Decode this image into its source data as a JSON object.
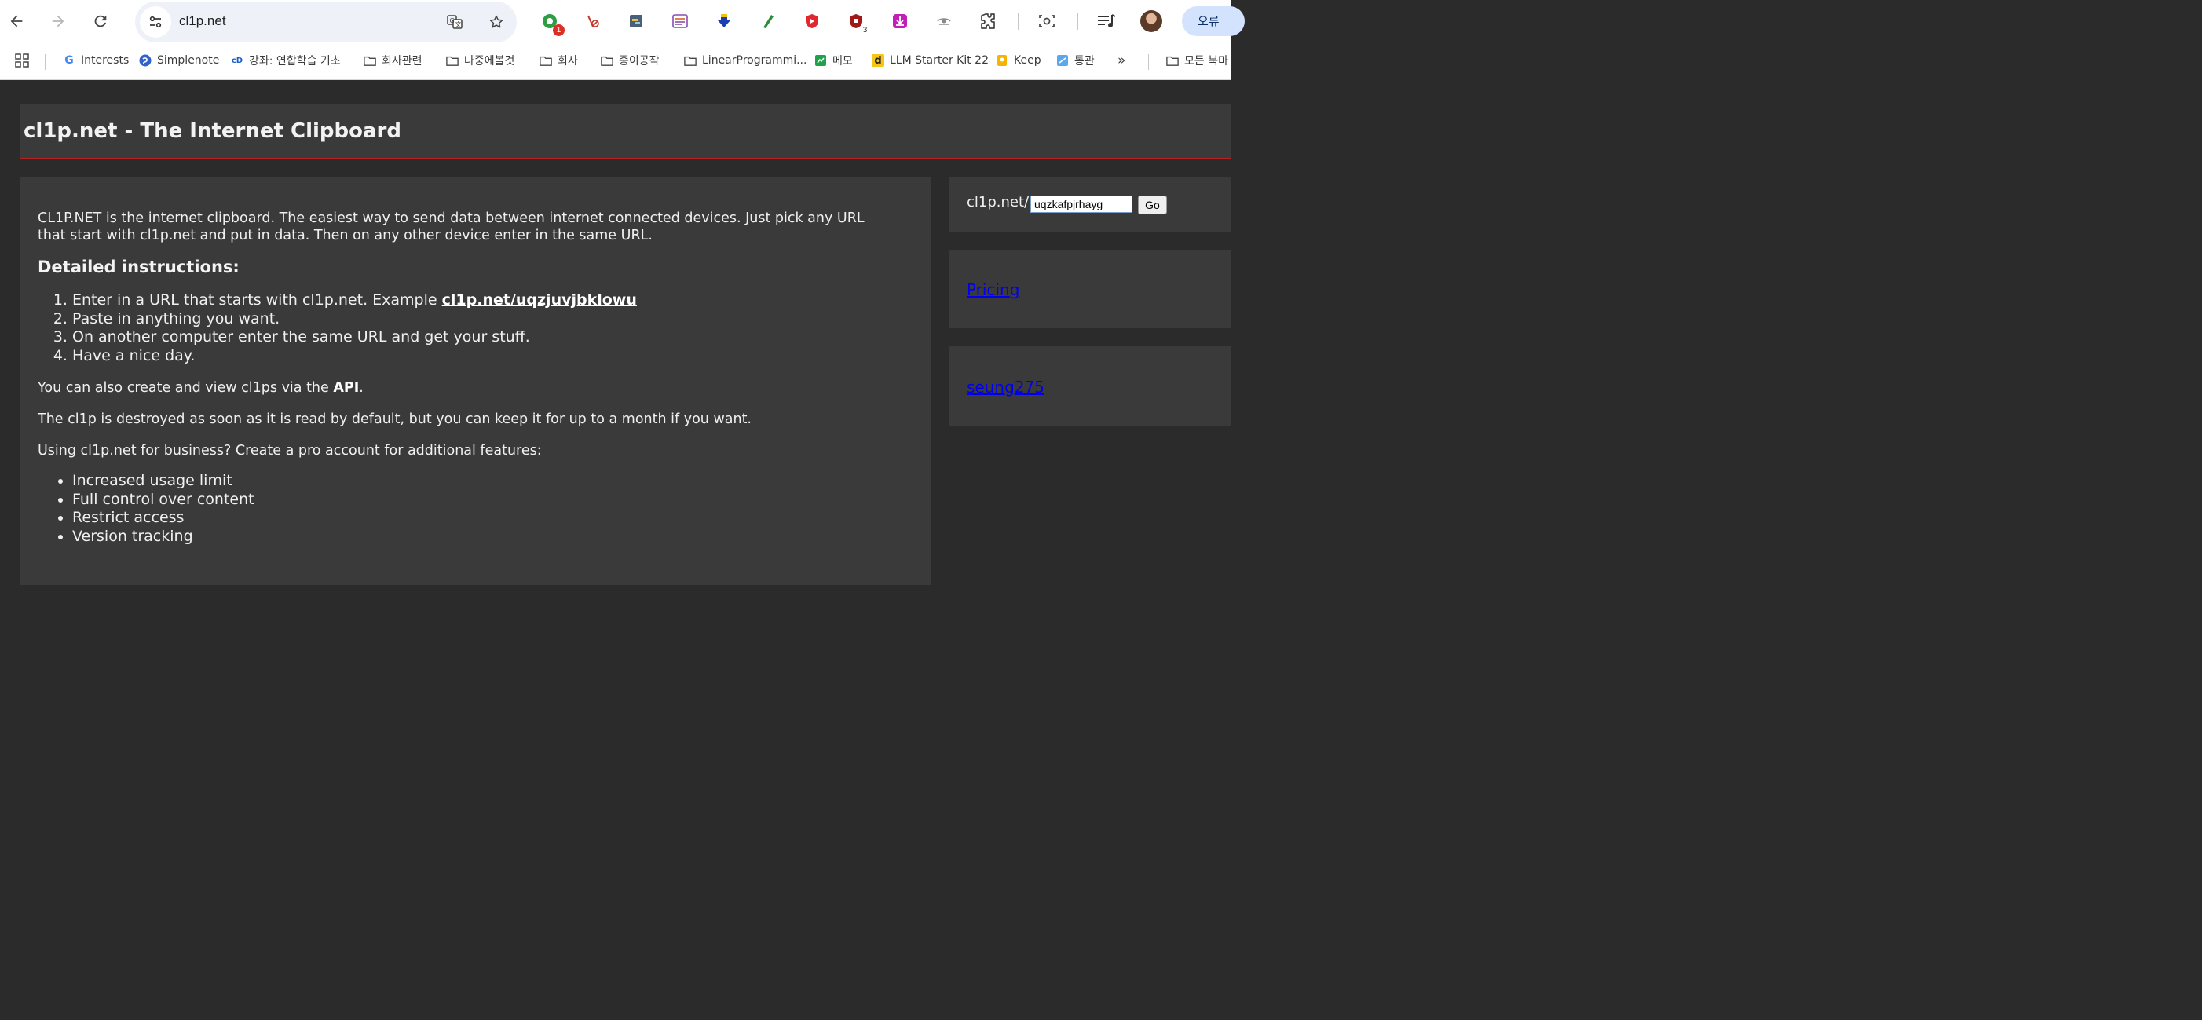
{
  "browser": {
    "url": "cl1p.net",
    "profile_label": "오류",
    "extensions": [
      {
        "name": "extension-1-icon",
        "badge": "1",
        "badge_color": "#d93025"
      },
      {
        "name": "extension-2-icon"
      },
      {
        "name": "extension-3-icon"
      },
      {
        "name": "extension-4-icon"
      },
      {
        "name": "extension-5-icon"
      },
      {
        "name": "extension-6-icon"
      },
      {
        "name": "extension-7-icon"
      },
      {
        "name": "extension-8-icon",
        "badge": "3"
      },
      {
        "name": "extension-9-icon"
      },
      {
        "name": "extension-10-icon"
      }
    ],
    "bookmarks": [
      {
        "label": "Interests",
        "icon": "google-icon"
      },
      {
        "label": "Simplenote",
        "icon": "simplenote-icon"
      },
      {
        "label": "강좌: 연합학습 기초",
        "icon": "course-icon"
      },
      {
        "label": "회사관련",
        "icon": "folder-icon"
      },
      {
        "label": "나중에볼것",
        "icon": "folder-icon"
      },
      {
        "label": "회사",
        "icon": "folder-icon"
      },
      {
        "label": "종이공작",
        "icon": "folder-icon"
      },
      {
        "label": "LinearProgrammi...",
        "icon": "folder-icon"
      },
      {
        "label": "메모",
        "icon": "memo-icon"
      },
      {
        "label": "LLM Starter Kit 22",
        "icon": "d-icon"
      },
      {
        "label": "Keep",
        "icon": "keep-icon"
      },
      {
        "label": "통관",
        "icon": "customs-icon"
      },
      {
        "label": "모든 북마",
        "icon": "folder-icon"
      }
    ],
    "more_bookmarks": "»"
  },
  "header": {
    "title": "cl1p.net - The Internet Clipboard"
  },
  "main": {
    "intro_line1": "CL1P.NET is the internet clipboard. The easiest way to send data between internet connected devices. Just pick any URL",
    "intro_line2": "that start with cl1p.net and put in data. Then on any other device enter in the same URL.",
    "instructions_heading": "Detailed instructions:",
    "step1_text": "Enter in a URL that starts with cl1p.net. Example ",
    "step1_link": "cl1p.net/uqzjuvjbklowu",
    "step2": "Paste in anything you want.",
    "step3": "On another computer enter the same URL and get your stuff.",
    "step4": "Have a nice day.",
    "api_prefix": "You can also create and view cl1ps via the ",
    "api_link": "API",
    "api_suffix": ".",
    "destroy_text": "The cl1p is destroyed as soon as it is read by default, but you can keep it for up to a month if you want.",
    "business_text": "Using cl1p.net for business? Create a pro account for additional features:",
    "features": [
      "Increased usage limit",
      "Full control over content",
      "Restrict access",
      "Version tracking"
    ]
  },
  "sidebar": {
    "url_prefix": "cl1p.net/",
    "url_input_value": "uqzkafpjrhayg",
    "go_label": "Go",
    "pricing_link": "Pricing",
    "user_link": "seung275"
  },
  "colors": {
    "page_bg": "#2b2b2b",
    "panel_bg": "#3a3a3a",
    "header_rule": "#b92020"
  }
}
